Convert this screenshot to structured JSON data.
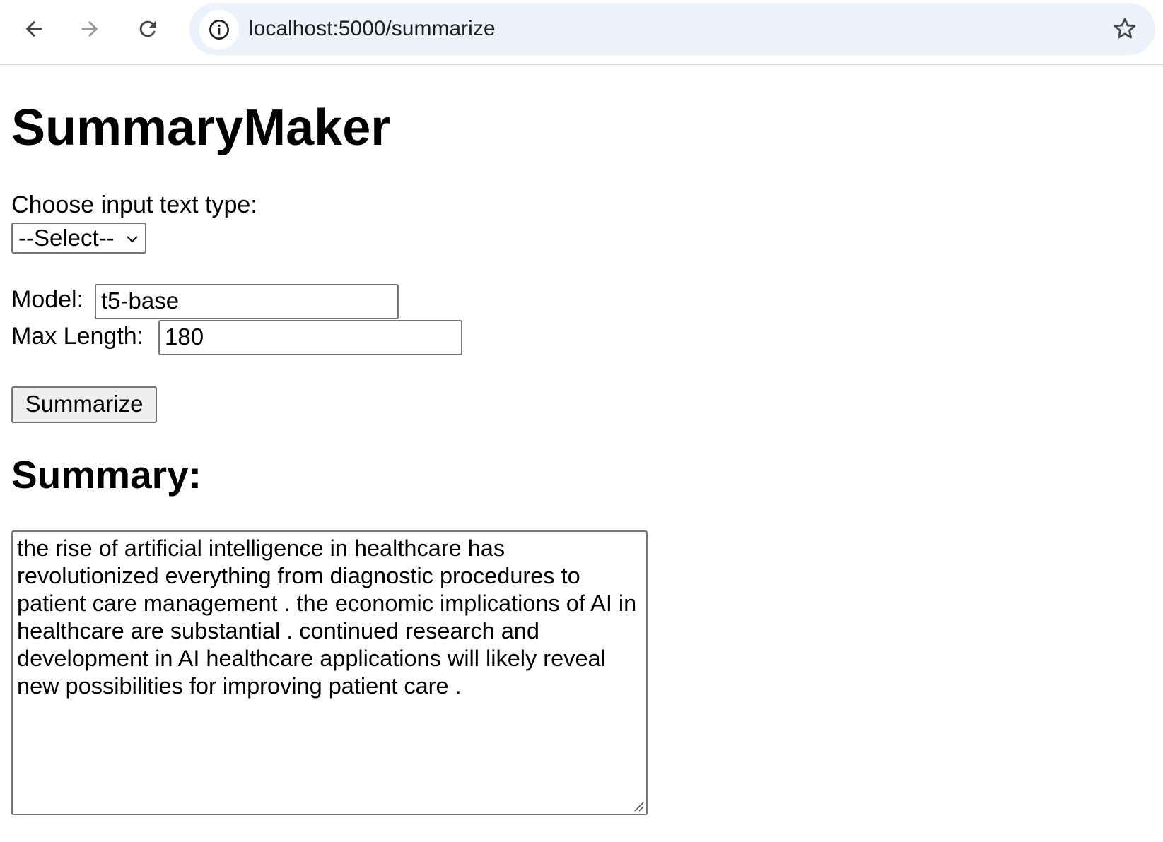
{
  "browser": {
    "url": "localhost:5000/summarize",
    "icons": {
      "back": "arrow-left-icon",
      "forward": "arrow-right-icon",
      "reload": "reload-icon",
      "site_info": "info-icon",
      "bookmark": "star-icon"
    }
  },
  "page": {
    "title": "SummaryMaker",
    "input_type_label": "Choose input text type:",
    "input_type_selected": "--Select--",
    "model_label": "Model:",
    "model_value": "t5-base",
    "max_length_label": "Max Length:",
    "max_length_value": "180",
    "submit_label": "Summarize",
    "summary_heading": "Summary:",
    "summary_text": "the rise of artificial intelligence in healthcare has revolutionized everything from diagnostic procedures to patient care management . the economic implications of AI in healthcare are substantial . continued research and development in AI healthcare applications will likely reveal new possibilities for improving patient care ."
  }
}
